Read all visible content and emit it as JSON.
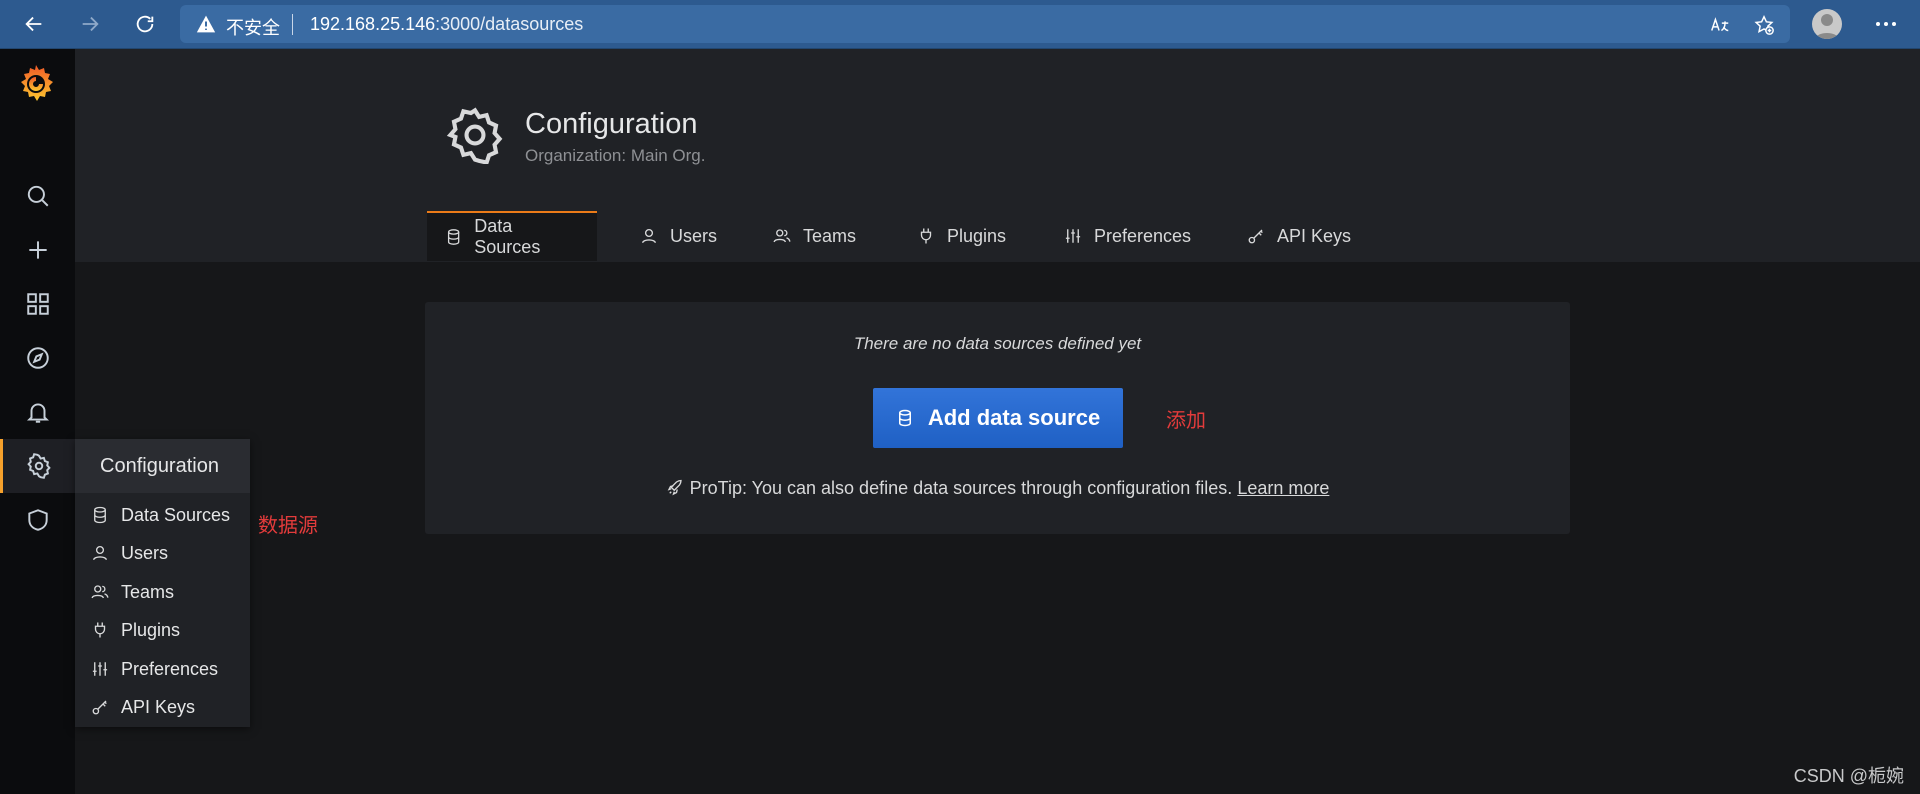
{
  "browser": {
    "security_label": "不安全",
    "url_host": "192.168.25.146",
    "url_path": ":3000/datasources"
  },
  "flyout": {
    "title": "Configuration",
    "items": [
      {
        "label": "Data Sources",
        "icon": "database-icon"
      },
      {
        "label": "Users",
        "icon": "user-icon"
      },
      {
        "label": "Teams",
        "icon": "users-icon"
      },
      {
        "label": "Plugins",
        "icon": "plug-icon"
      },
      {
        "label": "Preferences",
        "icon": "sliders-icon"
      },
      {
        "label": "API Keys",
        "icon": "key-icon"
      }
    ]
  },
  "annotations": {
    "datasource": "数据源",
    "add": "添加",
    "watermark": "CSDN @栀婉"
  },
  "header": {
    "title": "Configuration",
    "subtitle": "Organization: Main Org."
  },
  "tabs": [
    {
      "label": "Data Sources",
      "icon": "database-icon",
      "active": true
    },
    {
      "label": "Users",
      "icon": "user-icon"
    },
    {
      "label": "Teams",
      "icon": "users-icon"
    },
    {
      "label": "Plugins",
      "icon": "plug-icon"
    },
    {
      "label": "Preferences",
      "icon": "sliders-icon"
    },
    {
      "label": "API Keys",
      "icon": "key-icon"
    }
  ],
  "empty": {
    "title": "There are no data sources defined yet",
    "button_label": "Add data source",
    "protip": "ProTip: You can also define data sources through configuration files.",
    "learn_more": "Learn more"
  },
  "colors": {
    "accent": "#eb7b18",
    "primary_button": "#3274d9",
    "annotation": "#e23b3b"
  }
}
